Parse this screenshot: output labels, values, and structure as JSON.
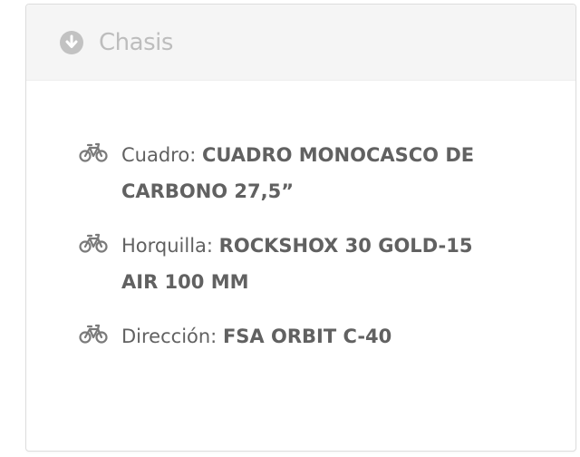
{
  "panel": {
    "title": "Chasis",
    "toggle_icon": "arrow-circle-down-icon"
  },
  "specs": [
    {
      "icon": "bicycle-icon",
      "label": "Cuadro: ",
      "value": "CUADRO MONOCASCO DE CARBONO 27,5”"
    },
    {
      "icon": "bicycle-icon",
      "label": "Horquilla: ",
      "value": "ROCKSHOX 30 GOLD-15 AIR 100 MM"
    },
    {
      "icon": "bicycle-icon",
      "label": "Dirección: ",
      "value": "FSA ORBIT C-40"
    }
  ],
  "colors": {
    "header_bg": "#f5f5f5",
    "title": "#bdbdbd",
    "icon": "#7a7a7a",
    "text": "#616161",
    "border": "#dddddd"
  }
}
